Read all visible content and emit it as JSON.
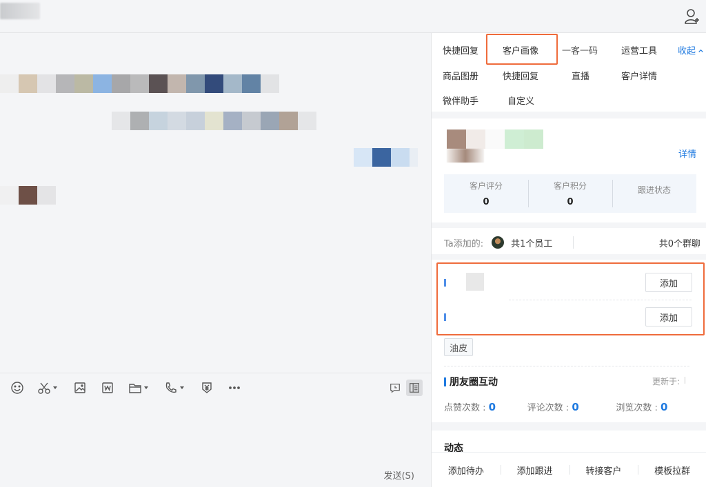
{
  "topbar": {
    "add_user_icon": "add-user-icon"
  },
  "panel": {
    "tabs_row1": [
      "快捷回复",
      "客户画像",
      "一客一码",
      "运营工具"
    ],
    "collapse_label": "收起",
    "tabs_row2": [
      "商品图册",
      "快捷回复",
      "直播",
      "客户详情"
    ],
    "tabs_row3": [
      "微伴助手",
      "自定义"
    ],
    "detail_link": "详情",
    "stats": [
      {
        "label": "客户评分",
        "value": "0"
      },
      {
        "label": "客户积分",
        "value": "0"
      },
      {
        "label": "跟进状态",
        "value": ""
      }
    ],
    "added_label": "Ta添加的:",
    "employee_count": "共1个员工",
    "group_count": "共0个群聊",
    "add_button_label": "添加",
    "tag": "油皮",
    "moments_title": "朋友圈互动",
    "updated_label": "更新于:",
    "counts": [
      {
        "label": "点赞次数 : ",
        "value": "0"
      },
      {
        "label": "评论次数 : ",
        "value": "0"
      },
      {
        "label": "浏览次数 : ",
        "value": "0"
      }
    ],
    "activity_title": "动态",
    "footer_buttons": [
      "添加待办",
      "添加跟进",
      "转接客户",
      "模板拉群"
    ]
  },
  "composer": {
    "send_label": "发送(S)"
  },
  "colors": {
    "accent": "#1f7ae0",
    "highlight": "#ef6b3b"
  }
}
